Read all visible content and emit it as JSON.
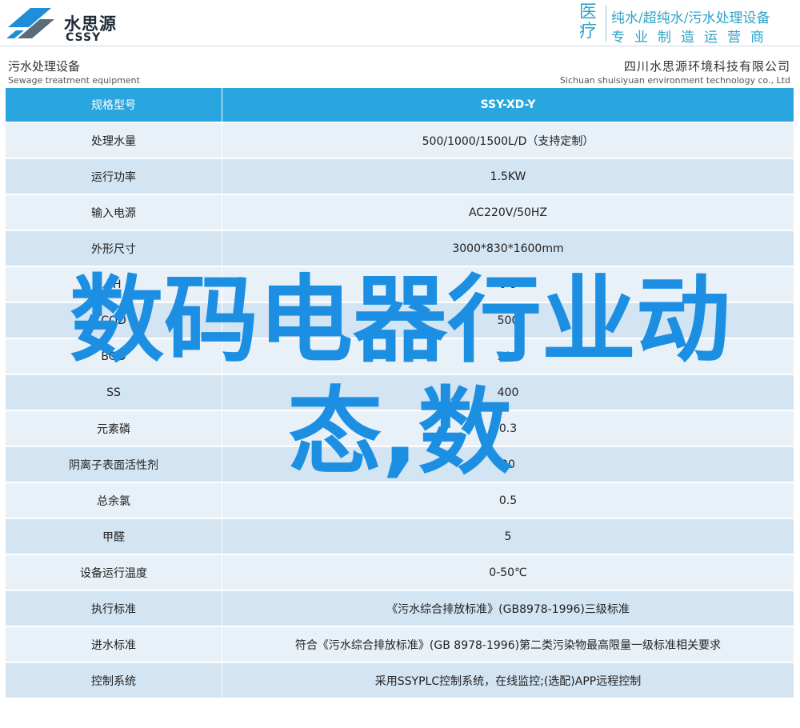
{
  "header": {
    "brand_cn": "水思源",
    "brand_en": "CSSY",
    "slogan_big": "医疗",
    "slogan_line1": "纯水/超纯水/污水处理设备",
    "slogan_line2": "专业制造运营商",
    "accent": "#2ea3c9"
  },
  "sub": {
    "left_cn": "污水处理设备",
    "left_en": "Sewage treatment equipment",
    "right_cn": "四川水思源环境科技有限公司",
    "right_en": "Sichuan shuisiyuan environment technology co., Ltd"
  },
  "table": {
    "header": {
      "key": "规格型号",
      "value": "SSY-XD-Y"
    },
    "rows": [
      {
        "key": "处理水量",
        "value": "500/1000/1500L/D（支持定制）"
      },
      {
        "key": "运行功率",
        "value": "1.5KW"
      },
      {
        "key": "输入电源",
        "value": "AC220V/50HZ"
      },
      {
        "key": "外形尺寸",
        "value": "3000*830*1600mm"
      },
      {
        "key": "PH",
        "value": "6-9"
      },
      {
        "key": "COD",
        "value": "500"
      },
      {
        "key": "BOD",
        "value": "300"
      },
      {
        "key": "SS",
        "value": "400"
      },
      {
        "key": "元素磷",
        "value": "0.3"
      },
      {
        "key": "阴离子表面活性剂",
        "value": "20"
      },
      {
        "key": "总余氯",
        "value": "0.5"
      },
      {
        "key": "甲醛",
        "value": "5"
      },
      {
        "key": "设备运行温度",
        "value": "0-50℃"
      },
      {
        "key": "执行标准",
        "value": "《污水综合排放标准》(GB8978-1996)三级标准"
      },
      {
        "key": "进水标准",
        "value": "符合《污水综合排放标准》(GB 8978-1996)第二类污染物最高限量一级标准相关要求"
      },
      {
        "key": "控制系统",
        "value": "采用SSYPLC控制系统，在线监控;(选配)APP远程控制"
      }
    ],
    "header_color": "#29a6e0",
    "row_colors": [
      "#e8f1f8",
      "#d3e4f2"
    ]
  },
  "overlay": {
    "line1": "数码电器行业动",
    "line2": "态,数",
    "color": "#1c8fe3"
  }
}
